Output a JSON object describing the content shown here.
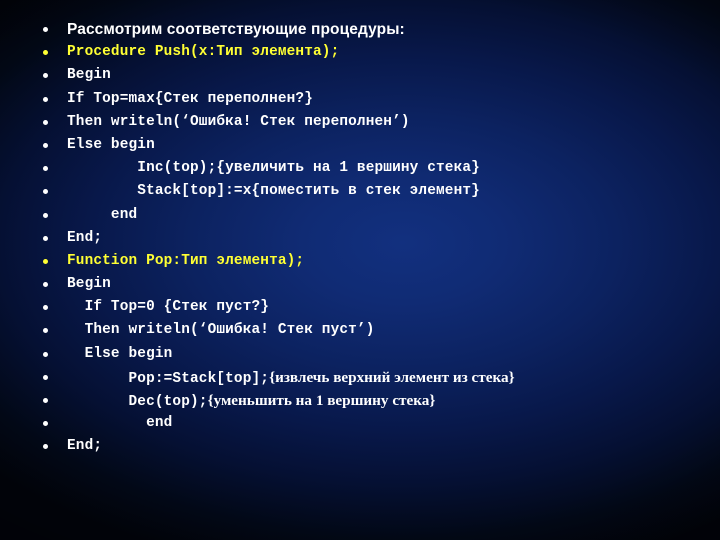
{
  "slide": {
    "background_dark": "#01030a",
    "background_center": "#12307f",
    "text_color": "#ffffff",
    "accent_color": "#ffff33",
    "lines": [
      {
        "text": "Рассмотрим соответствующие процедуры:",
        "style": "head",
        "highlight": false
      },
      {
        "text": "Procedure Push(x:Тип элемента);",
        "style": "code",
        "highlight": true
      },
      {
        "text": "Begin",
        "style": "code",
        "highlight": false
      },
      {
        "text": "If Top=max{Стек переполнен?}",
        "style": "code",
        "highlight": false
      },
      {
        "text": "Then writeln(‘Ошибка! Стек переполнен’)",
        "style": "code",
        "highlight": false
      },
      {
        "text": "Else begin",
        "style": "code",
        "highlight": false
      },
      {
        "text": "        Inc(top);{увеличить на 1 вершину стека}",
        "style": "code",
        "highlight": false
      },
      {
        "text": "        Stack[top]:=x{поместить в стек элемент}",
        "style": "code",
        "highlight": false
      },
      {
        "text": "     end",
        "style": "code",
        "highlight": false
      },
      {
        "text": "End;",
        "style": "code",
        "highlight": false
      },
      {
        "text": "Function Pop:Тип элемента);",
        "style": "code",
        "highlight": true
      },
      {
        "text": "Begin",
        "style": "code",
        "highlight": false
      },
      {
        "text": "  If Top=0 {Стек пуст?}",
        "style": "code",
        "highlight": false
      },
      {
        "text": "  Then writeln(‘Ошибка! Стек пуст’)",
        "style": "code",
        "highlight": false
      },
      {
        "text": "  Else begin",
        "style": "code",
        "highlight": false
      },
      {
        "text": "       Pop:=Stack[top];",
        "tail": "{извлечь верхний элемент из стека}",
        "style": "mixed",
        "highlight": false
      },
      {
        "text": "       Dec(top);",
        "tail": "{уменьшить на 1 вершину стека}",
        "style": "mixed",
        "highlight": false
      },
      {
        "text": "         end",
        "style": "code",
        "highlight": false
      },
      {
        "text": "End;",
        "style": "code",
        "highlight": false
      }
    ]
  }
}
